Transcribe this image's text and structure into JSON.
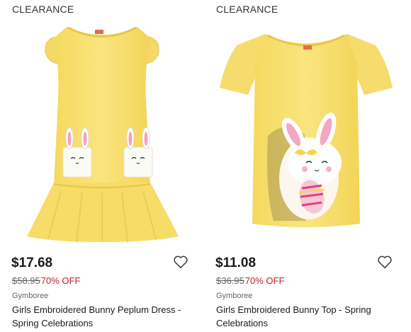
{
  "products": [
    {
      "badge": "CLEARANCE",
      "price": "$17.68",
      "original_price": "$58.95",
      "discount": "70% OFF",
      "brand": "Gymboree",
      "title": "Girls Embroidered Bunny Peplum Dress - Spring Celebrations",
      "image": "yellow-bunny-peplum-dress",
      "favorite_icon": "heart-outline-icon"
    },
    {
      "badge": "CLEARANCE",
      "price": "$11.08",
      "original_price": "$36.95",
      "discount": "70% OFF",
      "brand": "Gymboree",
      "title": "Girls Embroidered Bunny Top - Spring Celebrations",
      "image": "yellow-bunny-top",
      "favorite_icon": "heart-outline-icon"
    }
  ],
  "colors": {
    "garment": "#f7e27a",
    "discount": "#c01c28",
    "price": "#1a1a1a"
  }
}
